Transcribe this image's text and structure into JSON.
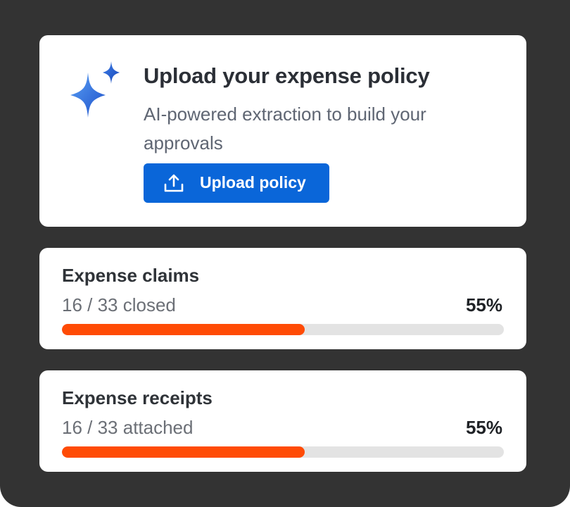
{
  "policy": {
    "title": "Upload your expense policy",
    "description": "AI-powered extraction to build your approvals",
    "button_label": "Upload policy",
    "icon": "sparkle-icon",
    "button_icon": "upload-icon",
    "accent_color": "#0a66d9"
  },
  "stats": [
    {
      "title": "Expense claims",
      "subtitle": "16 / 33 closed",
      "percent_label": "55%",
      "progress": 0.55
    },
    {
      "title": "Expense receipts",
      "subtitle": "16 / 33 attached",
      "percent_label": "55%",
      "progress": 0.55
    }
  ],
  "colors": {
    "frame": "#333333",
    "progress_fill": "#ff4b05",
    "progress_track": "#e3e3e3"
  }
}
